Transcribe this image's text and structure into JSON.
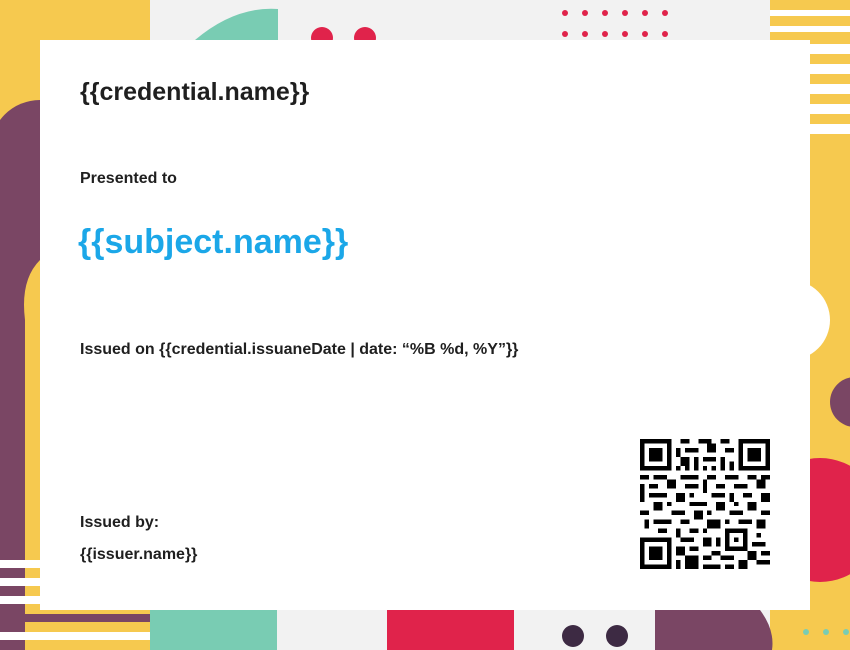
{
  "certificate": {
    "credential_name": "{{credential.name}}",
    "presented_to_label": "Presented to",
    "subject_name": "{{subject.name}}",
    "issued_on_label": "Issued on",
    "issued_on_value": "{{credential.issuaneDate | date: “%B %d, %Y”}}",
    "issued_by_label": "Issued by:",
    "issuer_name": "{{issuer.name}}"
  },
  "colors": {
    "accent_blue": "#1ba7e8",
    "yellow": "#f6c94f",
    "purple": "#7a4664",
    "teal": "#79ccb3",
    "red": "#e0234b",
    "dark": "#3d2a43"
  },
  "icons": [
    "qr-code-icon"
  ]
}
